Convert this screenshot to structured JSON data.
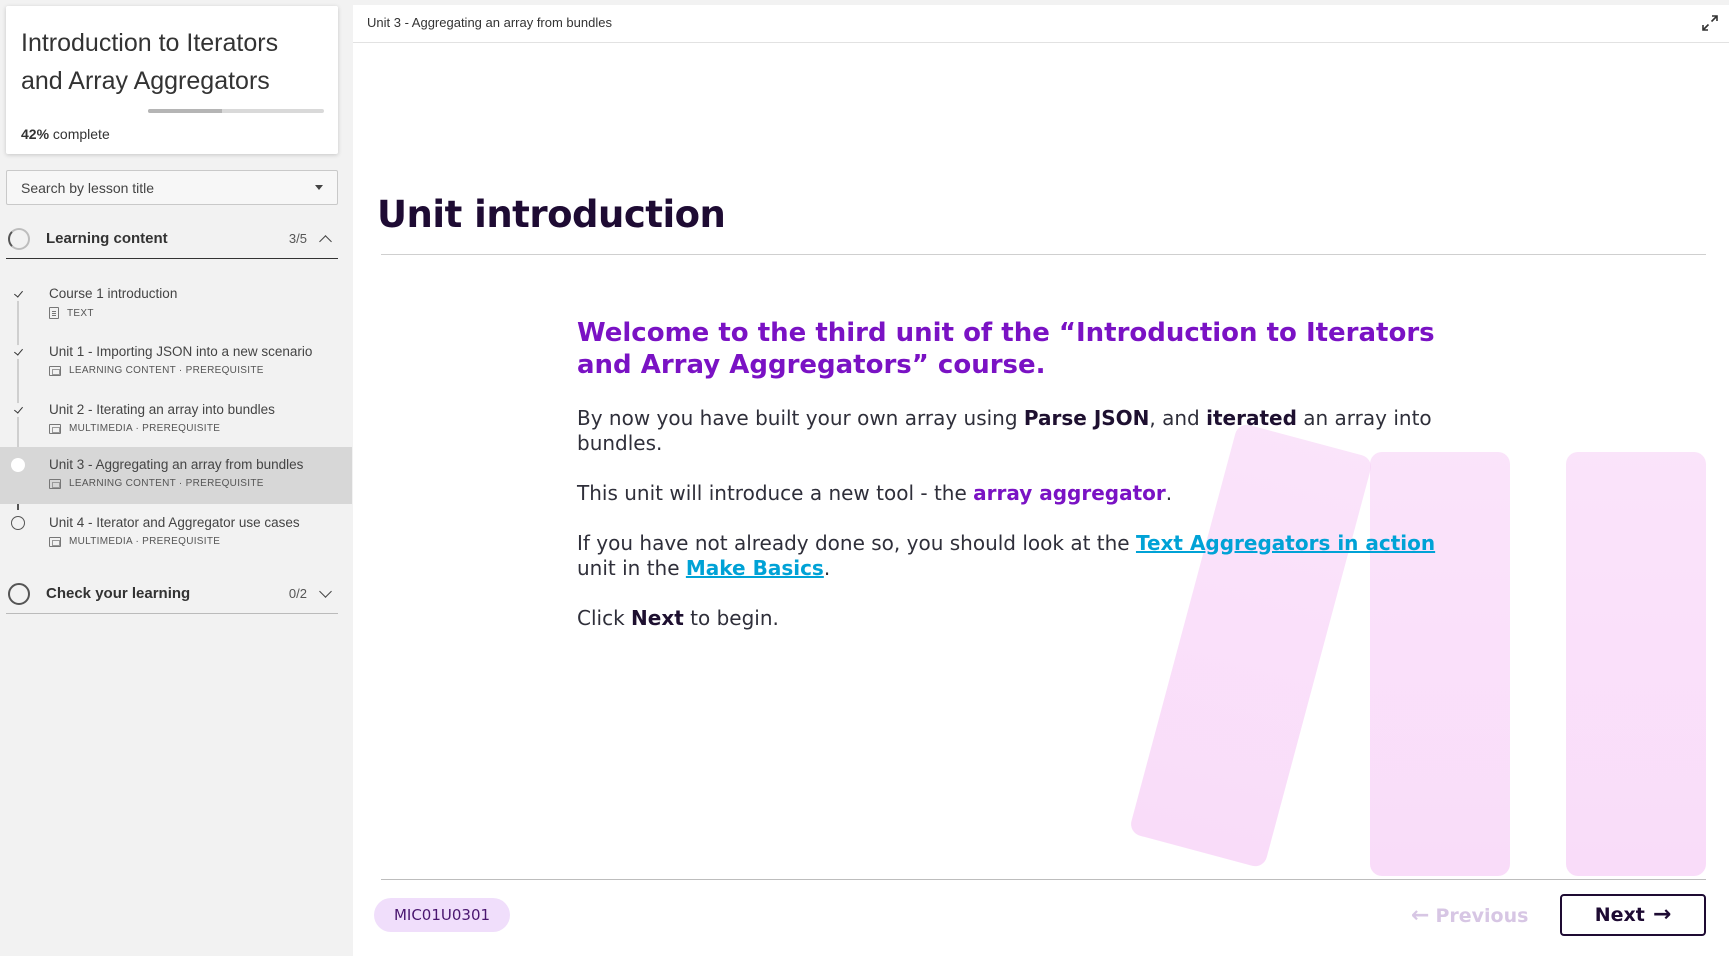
{
  "course": {
    "title": "Introduction to Iterators and Array Aggregators",
    "progress_percent": 42,
    "progress_percent_label": "42%",
    "progress_suffix": "complete"
  },
  "search": {
    "placeholder": "Search by lesson title"
  },
  "sections": [
    {
      "title": "Learning content",
      "count": "3/5",
      "expanded": true,
      "lessons": [
        {
          "title": "Course 1 introduction",
          "meta": "TEXT",
          "icon": "document-icon",
          "status": "complete"
        },
        {
          "title": "Unit 1 - Importing JSON into a new scenario",
          "meta": "LEARNING CONTENT · PREREQUISITE",
          "icon": "media-icon",
          "status": "complete"
        },
        {
          "title": "Unit 2 - Iterating an array into bundles",
          "meta": "MULTIMEDIA · PREREQUISITE",
          "icon": "media-icon",
          "status": "complete"
        },
        {
          "title": "Unit 3 - Aggregating an array from bundles",
          "meta": "LEARNING CONTENT · PREREQUISITE",
          "icon": "media-icon",
          "status": "current"
        },
        {
          "title": "Unit 4 - Iterator and Aggregator use cases",
          "meta": "MULTIMEDIA · PREREQUISITE",
          "icon": "media-icon",
          "status": "not-started"
        }
      ]
    },
    {
      "title": "Check your learning",
      "count": "0/2",
      "expanded": false
    }
  ],
  "main": {
    "breadcrumb": "Unit 3 - Aggregating an array from bundles",
    "heading": "Unit introduction",
    "welcome": "Welcome to the third unit of the “Introduction to Iterators and Array Aggregators” course.",
    "p1": {
      "t1": "By now you have built your own array using ",
      "b1": "Parse JSON",
      "t2": ", and ",
      "b2": "iterated",
      "t3": " an array into bundles."
    },
    "p2": {
      "t1": "This unit will introduce a new tool - the ",
      "accent": "array aggregator",
      "t2": "."
    },
    "p3": {
      "t1": "If you have not already done so, you should look at the ",
      "link1": "Text Aggregators in action",
      "t2": " unit in the ",
      "link2": "Make Basics",
      "t3": "."
    },
    "p4": {
      "t1": "Click ",
      "b1": "Next",
      "t2": " to begin."
    }
  },
  "footer": {
    "code": "MIC01U0301",
    "previous_label": "Previous",
    "next_label": "Next"
  },
  "colors": {
    "accent_purple": "#7a12c4",
    "link_cyan": "#00a2d6",
    "heading_dark": "#1e0b33",
    "pill_bg": "#f0defb"
  }
}
